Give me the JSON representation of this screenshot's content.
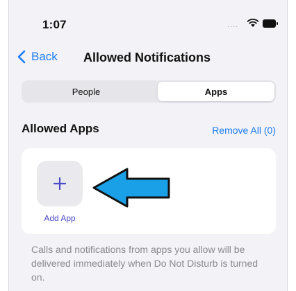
{
  "status_bar": {
    "time": "1:07",
    "signal": "....",
    "icons": [
      "wifi-icon",
      "battery-icon"
    ]
  },
  "nav": {
    "back_label": "Back",
    "title": "Allowed Notifications"
  },
  "segments": {
    "items": [
      {
        "label": "People",
        "selected": false
      },
      {
        "label": "Apps",
        "selected": true
      }
    ]
  },
  "section": {
    "title": "Allowed Apps",
    "remove_all": "Remove All (0)"
  },
  "card": {
    "add_app_label": "Add App",
    "plus_icon": "plus-icon",
    "annotation_icon": "arrow-left-icon"
  },
  "footer": {
    "text": "Calls and notifications from apps you allow will be delivered immediately when Do Not Disturb is turned on."
  },
  "colors": {
    "accent": "#1a7cf5",
    "add_app": "#4a4ac8",
    "arrow_fill": "#1aa0e6",
    "background": "#f2f2f7"
  }
}
